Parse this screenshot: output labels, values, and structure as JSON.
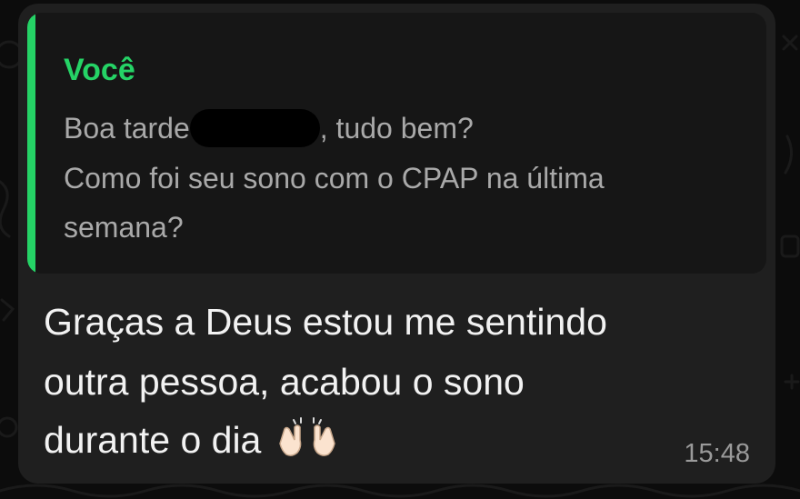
{
  "colors": {
    "background": "#0c0c0c",
    "bubble": "#1f1f1f",
    "quote_background": "#161616",
    "accent_green": "#25d366",
    "quote_text": "#a9a9a9",
    "message_text": "#f2f2f2",
    "timestamp": "#9a9a9a"
  },
  "quoted_message": {
    "author": "Você",
    "line1_before": "Boa tarde",
    "line1_after": ", tudo bem?",
    "line2": "Como foi seu sono com o CPAP na última",
    "line3": "semana?"
  },
  "message": {
    "line1": "Graças a Deus estou me sentindo",
    "line2": "outra pessoa, acabou o sono",
    "line3": "durante o dia",
    "emoji_icon": "raising-hands-icon",
    "time": "15:48"
  }
}
